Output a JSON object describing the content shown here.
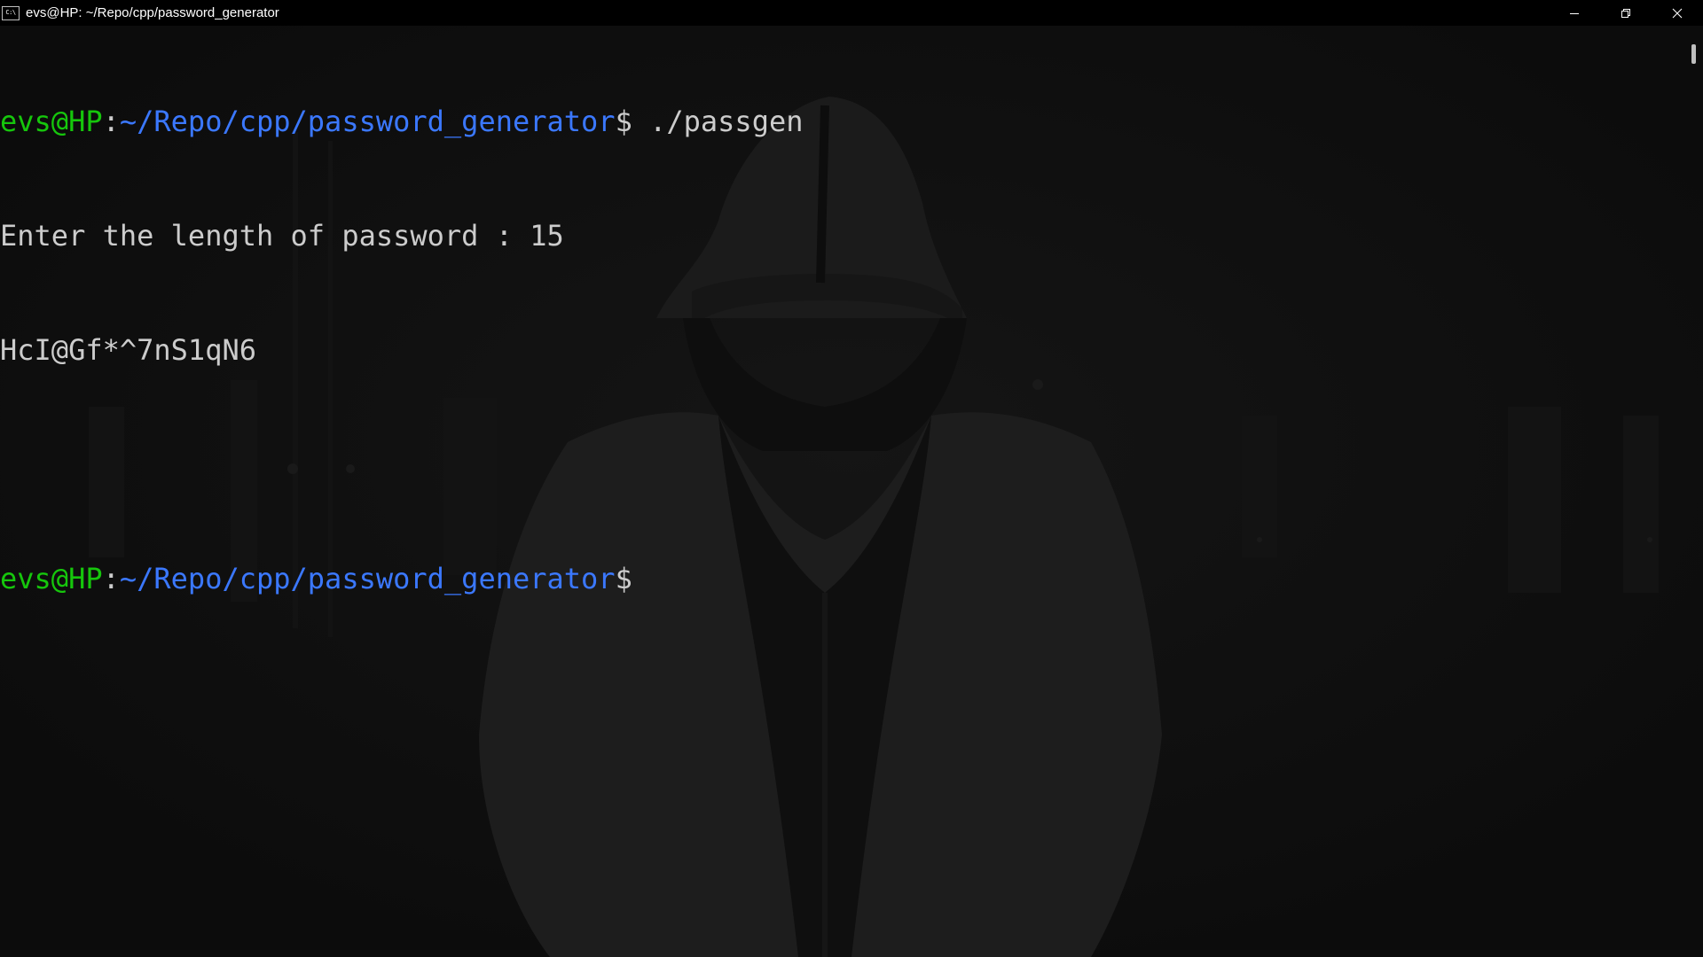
{
  "window": {
    "title": "evs@HP: ~/Repo/cpp/password_generator",
    "icon": "terminal-icon",
    "icon_glyph": "C:\\"
  },
  "controls": {
    "minimize": "minimize-icon",
    "maximize": "restore-icon",
    "close": "close-icon"
  },
  "terminal": {
    "prompt_user": "evs@HP",
    "prompt_colon": ":",
    "prompt_path": "~/Repo/cpp/password_generator",
    "prompt_symbol": "$",
    "lines": [
      {
        "command": " ./passgen"
      },
      {
        "text": "Enter the length of password : 15"
      },
      {
        "text": "HcI@Gf*^7nS1qN6"
      },
      {
        "text": ""
      },
      {
        "command": ""
      }
    ]
  },
  "colors": {
    "background": "#0c0c0c",
    "user": "#16c60c",
    "path": "#3b78ff",
    "text": "#cccccc"
  }
}
